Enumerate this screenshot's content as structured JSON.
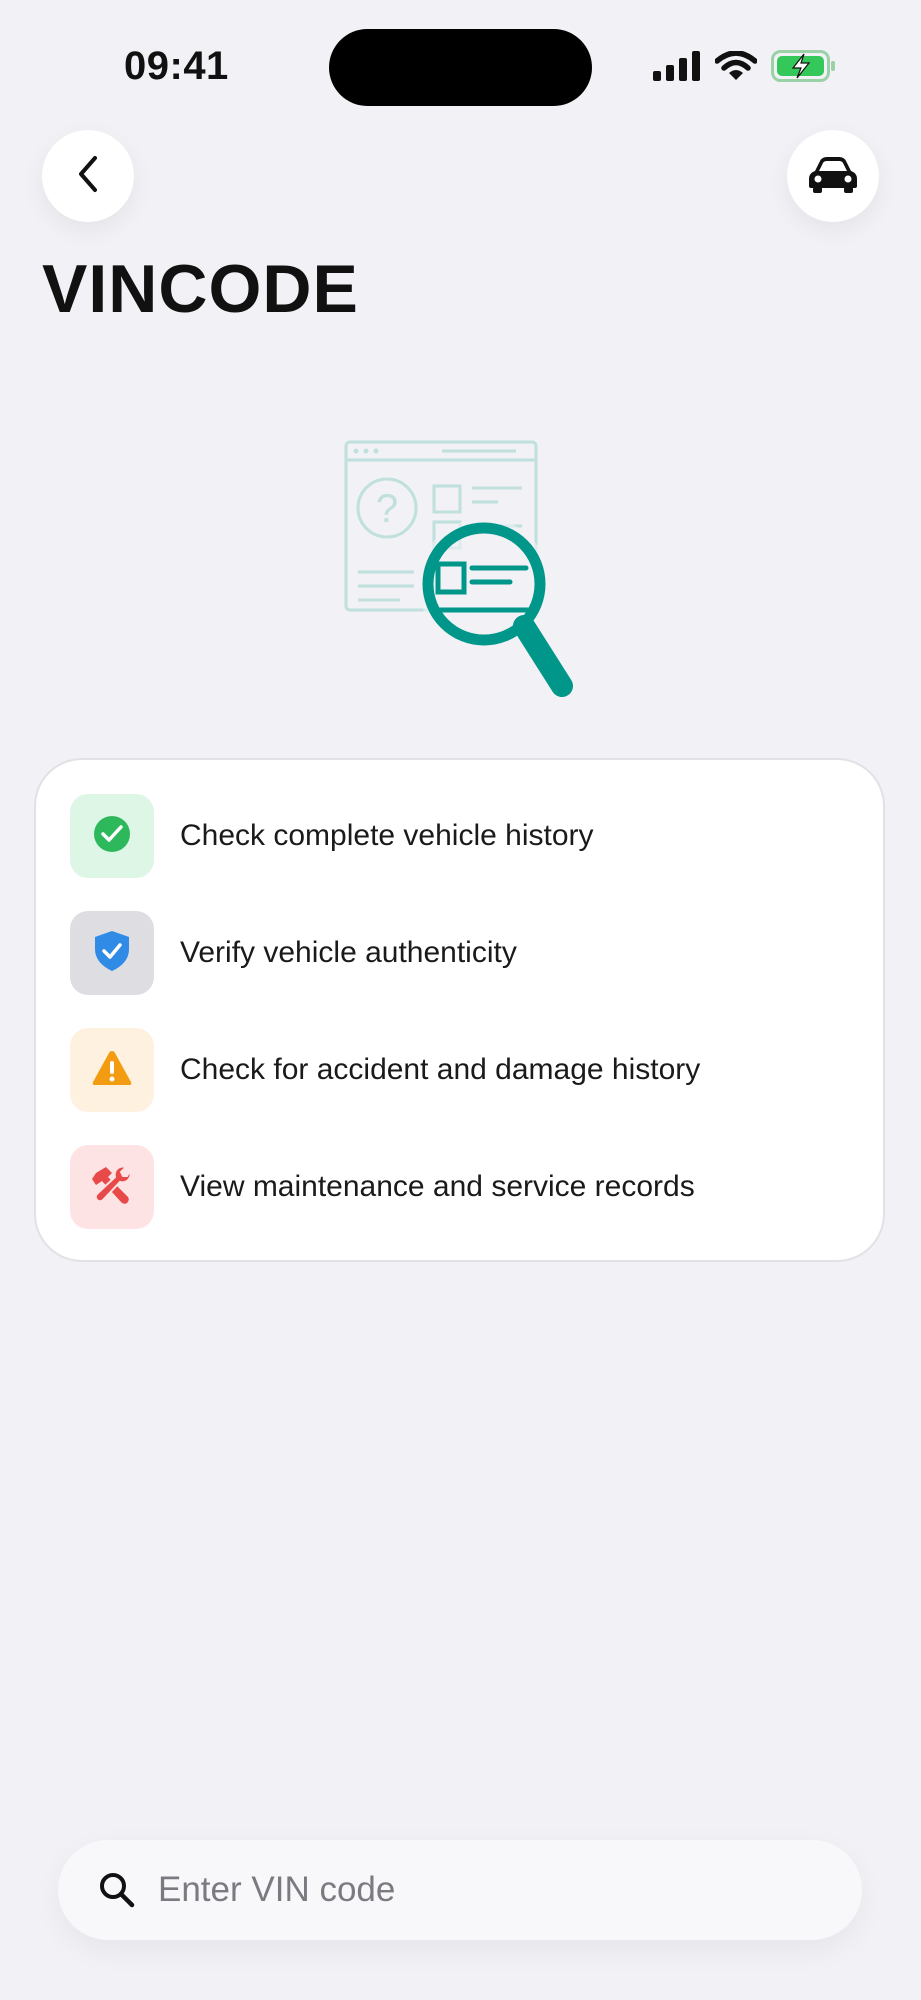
{
  "status_bar": {
    "time": "09:41"
  },
  "header": {
    "title": "VINCODE"
  },
  "features": [
    {
      "label": "Check complete vehicle history",
      "icon": "check-circle-icon",
      "bg": "#DDF6E6",
      "color": "#2EB85C"
    },
    {
      "label": "Verify vehicle authenticity",
      "icon": "shield-check-icon",
      "bg": "#DEDEE2",
      "color": "#2F8BE6"
    },
    {
      "label": "Check for accident and damage history",
      "icon": "warning-triangle-icon",
      "bg": "#FFF1E0",
      "color": "#F39C12"
    },
    {
      "label": "View maintenance and service records",
      "icon": "wrench-hammer-icon",
      "bg": "#FDE3E3",
      "color": "#E84A4A"
    }
  ],
  "search": {
    "placeholder": "Enter VIN code",
    "value": ""
  },
  "colors": {
    "accent": "#00968A",
    "background": "#F1F1F6"
  }
}
